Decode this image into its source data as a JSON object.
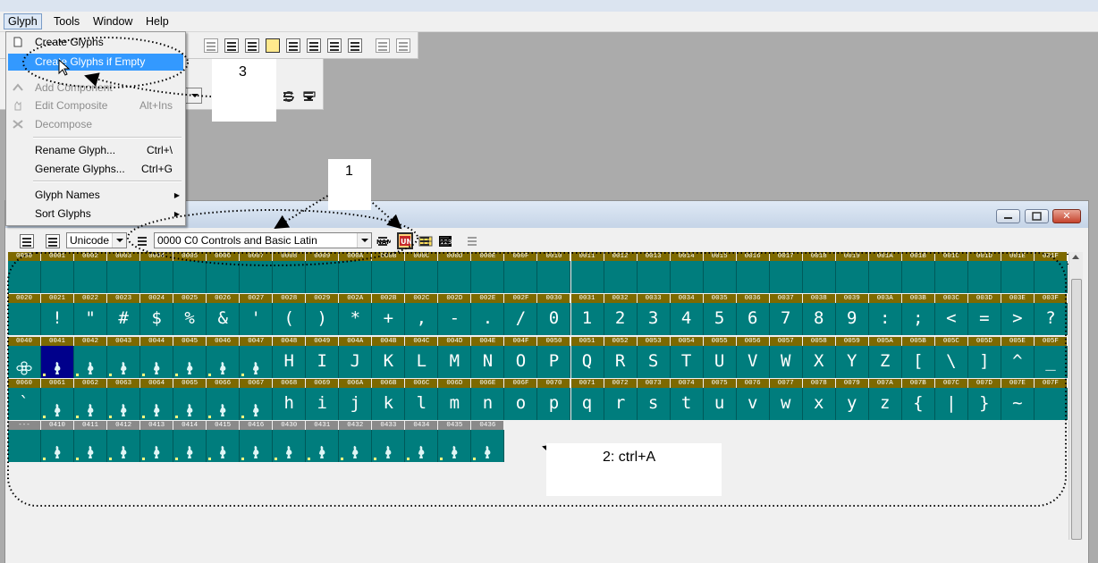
{
  "menubar": {
    "items": [
      "Glyph",
      "Tools",
      "Window",
      "Help"
    ]
  },
  "glyph_menu": {
    "items": [
      {
        "label": "Create Glyphs",
        "shortcut": "",
        "state": "normal"
      },
      {
        "label": "Create Glyphs if Empty",
        "shortcut": "",
        "state": "highlighted"
      },
      {
        "label": "Add Component",
        "shortcut": "",
        "state": "disabled"
      },
      {
        "label": "Edit Composite",
        "shortcut": "Alt+Ins",
        "state": "disabled"
      },
      {
        "label": "Decompose",
        "shortcut": "",
        "state": "disabled"
      },
      {
        "label": "Rename Glyph...",
        "shortcut": "Ctrl+\\",
        "state": "normal"
      },
      {
        "label": "Generate Glyphs...",
        "shortcut": "Ctrl+G",
        "state": "normal"
      },
      {
        "label": "Glyph Names",
        "shortcut": "",
        "state": "submenu"
      },
      {
        "label": "Sort Glyphs",
        "shortcut": "",
        "state": "submenu"
      }
    ]
  },
  "font_window": {
    "encoding_select": "Unicode",
    "range_select": "0000 C0 Controls and Basic Latin"
  },
  "grid": {
    "rows": [
      {
        "codes": [
          "0000",
          "0001",
          "0002",
          "0003",
          "0004",
          "0005",
          "0006",
          "0007",
          "0008",
          "0009",
          "000A",
          "000B",
          "000C",
          "000D",
          "000E",
          "000F",
          "0010",
          "0011",
          "0012",
          "0013",
          "0014",
          "0015",
          "0016",
          "0017",
          "0018",
          "0019",
          "001A",
          "001B",
          "001C",
          "001D",
          "001E",
          "001F"
        ],
        "chars": [
          "",
          "",
          "",
          "",
          "",
          "",
          "",
          "",
          "",
          "",
          "",
          "",
          "",
          "",
          "",
          "",
          "",
          "",
          "",
          "",
          "",
          "",
          "",
          "",
          "",
          "",
          "",
          "",
          "",
          "",
          "",
          ""
        ]
      },
      {
        "codes": [
          "0020",
          "0021",
          "0022",
          "0023",
          "0024",
          "0025",
          "0026",
          "0027",
          "0028",
          "0029",
          "002A",
          "002B",
          "002C",
          "002D",
          "002E",
          "002F",
          "0030",
          "0031",
          "0032",
          "0033",
          "0034",
          "0035",
          "0036",
          "0037",
          "0038",
          "0039",
          "003A",
          "003B",
          "003C",
          "003D",
          "003E",
          "003F"
        ],
        "chars": [
          "",
          "!",
          "\"",
          "#",
          "$",
          "%",
          "&",
          "'",
          "(",
          ")",
          "*",
          "+",
          ",",
          "-",
          ".",
          "/",
          "0",
          "1",
          "2",
          "3",
          "4",
          "5",
          "6",
          "7",
          "8",
          "9",
          ":",
          ";",
          "<",
          "=",
          ">",
          "?"
        ]
      },
      {
        "codes": [
          "0040",
          "0041",
          "0042",
          "0043",
          "0044",
          "0045",
          "0046",
          "0047",
          "0048",
          "0049",
          "004A",
          "004B",
          "004C",
          "004D",
          "004E",
          "004F",
          "0050",
          "0051",
          "0052",
          "0053",
          "0054",
          "0055",
          "0056",
          "0057",
          "0058",
          "0059",
          "005A",
          "005B",
          "005C",
          "005D",
          "005E",
          "005F"
        ],
        "chars": [
          "",
          "",
          "",
          "",
          "",
          "",
          "",
          "",
          "H",
          "I",
          "J",
          "K",
          "L",
          "M",
          "N",
          "O",
          "P",
          "Q",
          "R",
          "S",
          "T",
          "U",
          "V",
          "W",
          "X",
          "Y",
          "Z",
          "[",
          "\\",
          "]",
          "^",
          "_"
        ]
      },
      {
        "codes": [
          "0060",
          "0061",
          "0062",
          "0063",
          "0064",
          "0065",
          "0066",
          "0067",
          "0068",
          "0069",
          "006A",
          "006B",
          "006C",
          "006D",
          "006E",
          "006F",
          "0070",
          "0071",
          "0072",
          "0073",
          "0074",
          "0075",
          "0076",
          "0077",
          "0078",
          "0079",
          "007A",
          "007B",
          "007C",
          "007D",
          "007E",
          "007F"
        ],
        "chars": [
          "`",
          "",
          "",
          "",
          "",
          "",
          "",
          "",
          "h",
          "i",
          "j",
          "k",
          "l",
          "m",
          "n",
          "o",
          "p",
          "q",
          "r",
          "s",
          "t",
          "u",
          "v",
          "w",
          "x",
          "y",
          "z",
          "{",
          "|",
          "}",
          "~",
          ""
        ]
      },
      {
        "codes": [
          "---",
          "0410",
          "0411",
          "0412",
          "0413",
          "0414",
          "0415",
          "0416",
          "0430",
          "0431",
          "0432",
          "0433",
          "0434",
          "0435",
          "0436"
        ],
        "chars": [
          "",
          "",
          "",
          "",
          "",
          "",
          "",
          "",
          "",
          "",
          "",
          "",
          "",
          "",
          ""
        ]
      }
    ]
  },
  "annotations": {
    "note1": "1",
    "note2": "2: ctrl+A",
    "note3": "3"
  },
  "colors": {
    "cell_bg": "#007d7d",
    "header_gold": "#7d6900",
    "menu_highlight": "#3399ff",
    "selected_cell": "#00008b"
  }
}
